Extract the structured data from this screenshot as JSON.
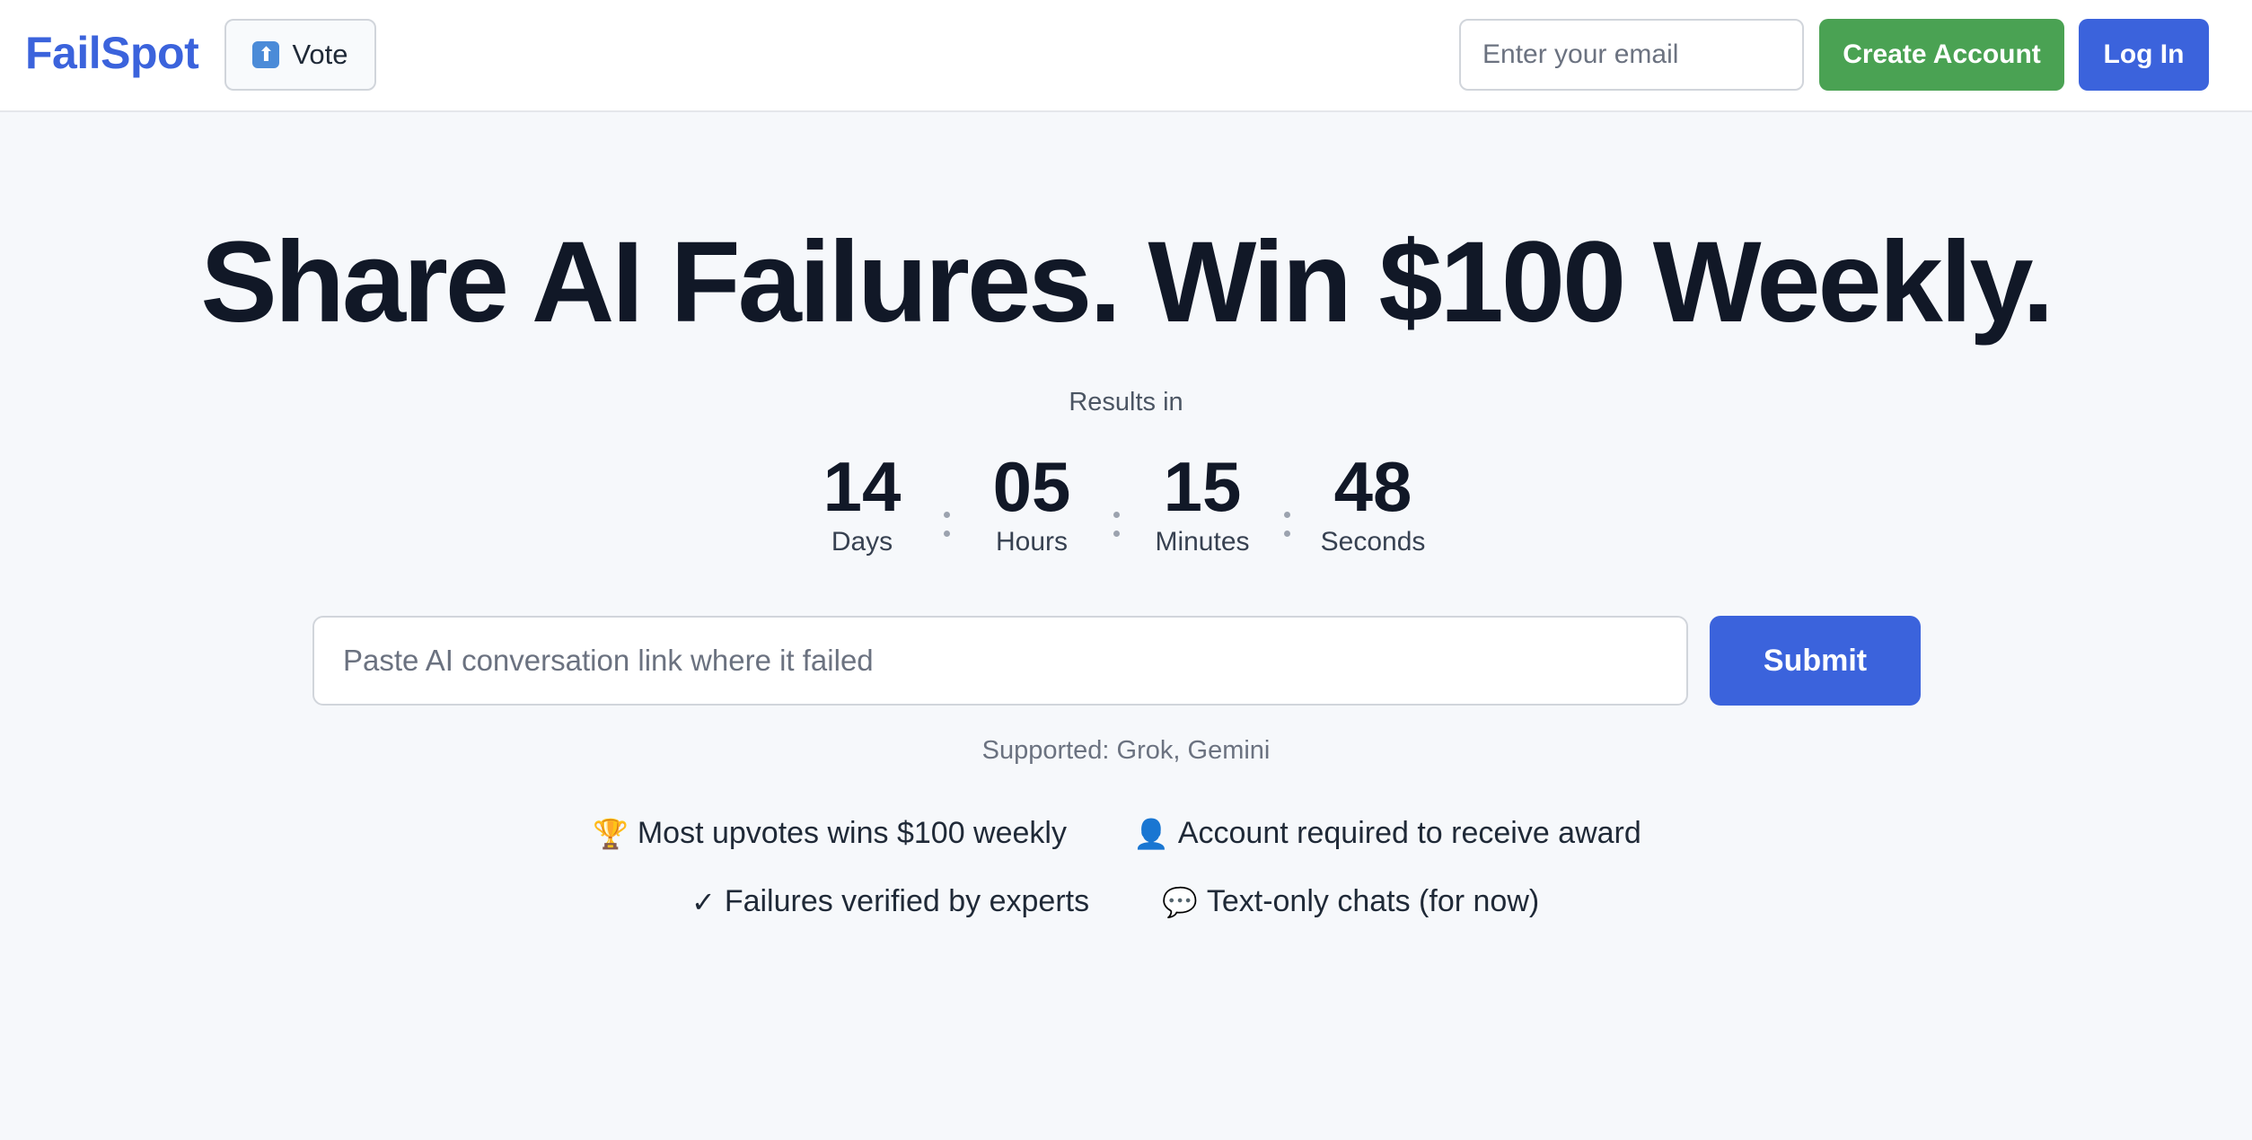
{
  "header": {
    "logo": "FailSpot",
    "vote_icon": "up-arrow-icon",
    "vote_label": "Vote",
    "email_placeholder": "Enter your email",
    "create_account_label": "Create Account",
    "login_label": "Log In"
  },
  "hero": {
    "headline": "Share AI Failures. Win $100 Weekly.",
    "results_label": "Results in"
  },
  "countdown": [
    {
      "value": "14",
      "label": "Days"
    },
    {
      "value": "05",
      "label": "Hours"
    },
    {
      "value": "15",
      "label": "Minutes"
    },
    {
      "value": "48",
      "label": "Seconds"
    }
  ],
  "submission": {
    "placeholder": "Paste AI conversation link where it failed",
    "submit_label": "Submit",
    "supported_text": "Supported: Grok, Gemini"
  },
  "features": [
    {
      "icon": "trophy-icon",
      "glyph": "🏆",
      "text": "Most upvotes wins $100 weekly"
    },
    {
      "icon": "person-icon",
      "glyph": "👤",
      "text": "Account required to receive award"
    },
    {
      "icon": "check-icon",
      "glyph": "✓",
      "text": "Failures verified by experts"
    },
    {
      "icon": "speech-bubble-icon",
      "glyph": "💬",
      "text": "Text-only chats (for now)"
    }
  ],
  "colors": {
    "brand": "#3b63dc",
    "create_account": "#4aa253",
    "background": "#f6f8fb",
    "text": "#111827"
  }
}
